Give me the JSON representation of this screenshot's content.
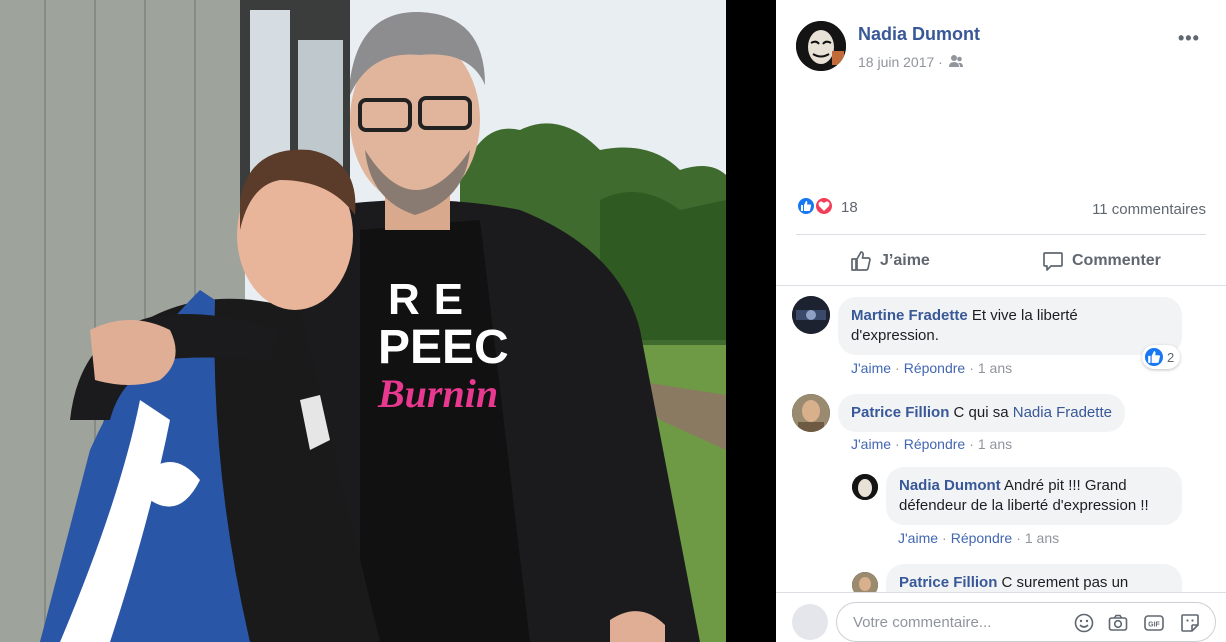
{
  "post": {
    "author": "Nadia Dumont",
    "date": "18 juin 2017 ·",
    "more_label": "•••",
    "reaction_count": "18",
    "comment_count": "11 commentaires",
    "like_action": "J’aime",
    "comment_action": "Commenter"
  },
  "comments": [
    {
      "name": "Martine Fradette",
      "text": " Et vive la liberté d'expression.",
      "like_label": "J'aime",
      "reply_label": "Répondre",
      "age": "1 ans",
      "likes": "2"
    },
    {
      "name": "Patrice Fillion",
      "text": " C qui sa ",
      "mention": "Nadia Fradette",
      "like_label": "J'aime",
      "reply_label": "Répondre",
      "age": "1 ans"
    },
    {
      "name": "Nadia Dumont",
      "text": " André pit !!! Grand défendeur de la liberté d'expression !!",
      "like_label": "J'aime",
      "reply_label": "Répondre",
      "age": "1 ans"
    },
    {
      "name": "Patrice Fillion",
      "text": " C surement pas un"
    }
  ],
  "composer": {
    "placeholder": "Votre commentaire..."
  },
  "photo": {
    "shirt_text_line1": "RE",
    "shirt_text_line2": "PEEC",
    "shirt_text_line3": "Burnin"
  },
  "colors": {
    "link": "#385898",
    "like_blue": "#1877f2",
    "love_red": "#f33e58",
    "bubble_bg": "#f2f3f5",
    "shirt_pink": "#e8388f"
  }
}
